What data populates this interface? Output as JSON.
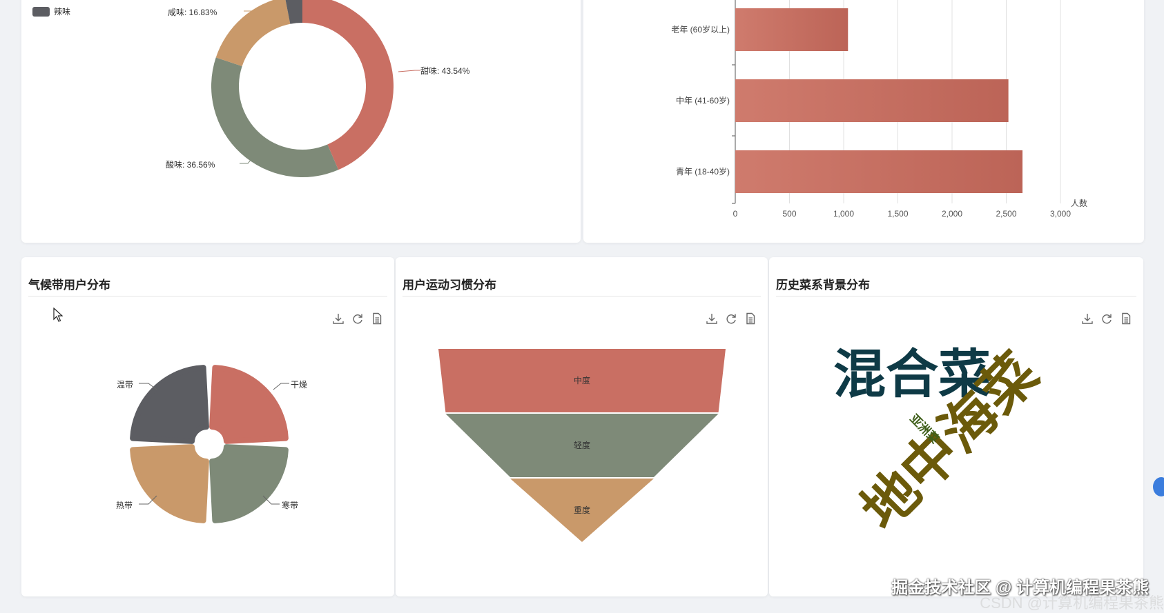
{
  "top_left": {
    "legend_label": "辣味",
    "donut_labels": {
      "sweet": "甜味: 43.54%",
      "sour": "酸味: 36.56%",
      "salty": "咸味: 16.83%"
    }
  },
  "top_right": {
    "axis_name": "人数"
  },
  "cards": {
    "climate": {
      "title": "气候带用户分布"
    },
    "exercise": {
      "title": "用户运动习惯分布"
    },
    "history": {
      "title": "历史菜系背景分布"
    }
  },
  "toolbox_icons": [
    "download-icon",
    "refresh-icon",
    "data-view-icon"
  ],
  "colors": {
    "red": "#c96f63",
    "green": "#7e8a78",
    "tan": "#c9996a",
    "gray": "#5c5d62",
    "navy": "#0e3a46",
    "olive": "#6b5a0a",
    "darkgreen": "#3f5f1a"
  },
  "chart_data": [
    {
      "type": "pie",
      "variant": "donut",
      "slices": [
        {
          "name": "甜味",
          "value": 43.54
        },
        {
          "name": "酸味",
          "value": 36.56
        },
        {
          "name": "咸味",
          "value": 16.83
        },
        {
          "name": "辣味",
          "value": 3.07
        }
      ],
      "legend": [
        "辣味"
      ]
    },
    {
      "type": "bar",
      "orientation": "horizontal",
      "categories": [
        "老年 (60岁以上)",
        "中年 (41-60岁)",
        "青年 (18-40岁)"
      ],
      "values": [
        1040,
        2520,
        2650
      ],
      "xlabel": "人数",
      "xticks": [
        "0",
        "500",
        "1,000",
        "1,500",
        "2,000",
        "2,500",
        "3,000"
      ],
      "xlim": [
        0,
        3000
      ],
      "grid": true
    },
    {
      "type": "pie",
      "variant": "rose",
      "slices": [
        {
          "name": "干燥",
          "value": 25
        },
        {
          "name": "寒带",
          "value": 25
        },
        {
          "name": "热带",
          "value": 25
        },
        {
          "name": "温带",
          "value": 25
        }
      ]
    },
    {
      "type": "funnel",
      "categories": [
        "中度",
        "轻度",
        "重度"
      ],
      "values": [
        100,
        95,
        50
      ]
    },
    {
      "type": "wordcloud",
      "words": [
        {
          "text": "混合菜",
          "weight": 3
        },
        {
          "text": "地中海菜",
          "weight": 3
        },
        {
          "text": "亚洲菜",
          "weight": 1
        }
      ]
    }
  ],
  "watermark": "掘金技术社区 @ 计算机编程果茶熊",
  "watermark_faded": "CSDN @计算机编程果茶熊"
}
